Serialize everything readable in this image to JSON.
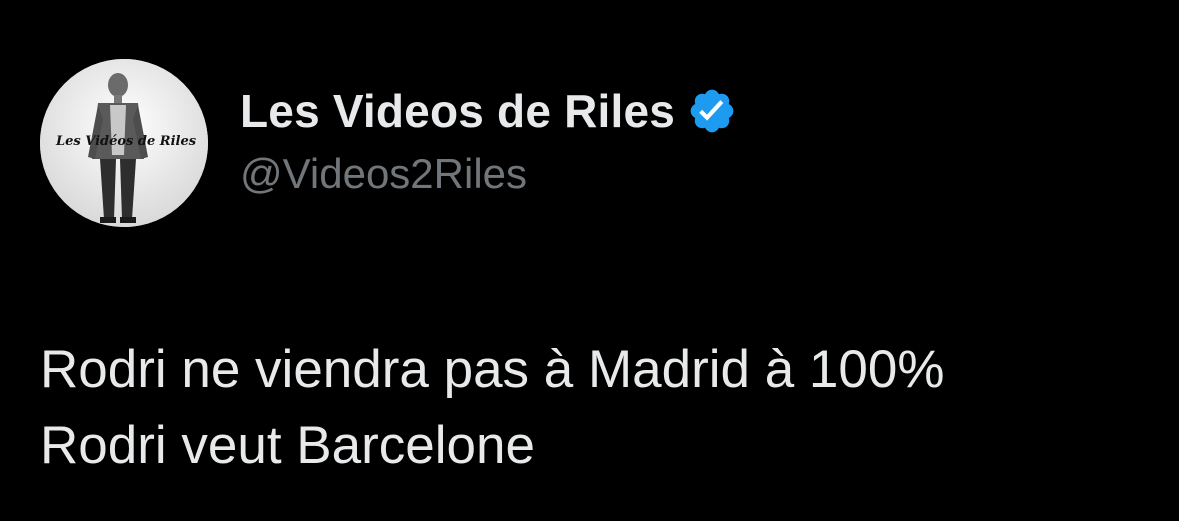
{
  "tweet": {
    "author": {
      "display_name": "Les Videos de Riles",
      "handle": "@Videos2Riles",
      "avatar_caption": "Les Vidéos de Riles",
      "verified": true,
      "verified_badge_color": "#1d9bf0",
      "avatar_icon": "avatar-image"
    },
    "text_lines": [
      "Rodri ne viendra pas à Madrid à 100%",
      "Rodri veut Barcelone"
    ]
  },
  "colors": {
    "background": "#000000",
    "primary_text": "#e7e9ea",
    "secondary_text": "#71767b"
  }
}
